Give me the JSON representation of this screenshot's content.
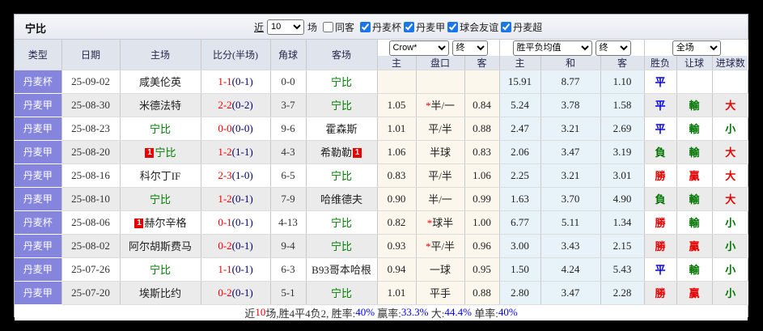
{
  "colors": {
    "red": "#e60000",
    "green": "#007500",
    "blue": "#0000ee",
    "black": "#333333",
    "league_cell": "#8585de",
    "crow_col_bg": "#fcf7ed",
    "avg_col_bg": "#e7f3f8"
  },
  "topbar": {
    "team": "宁比",
    "recent_label": "近",
    "recent_value": "10",
    "matches_label": "场",
    "same_away_label": "同客",
    "same_away_checked": false,
    "leagues": [
      {
        "label": "丹麦杯",
        "checked": true
      },
      {
        "label": "丹麦甲",
        "checked": true
      },
      {
        "label": "球会友谊",
        "checked": true
      },
      {
        "label": "丹麦超",
        "checked": true
      }
    ]
  },
  "selects": {
    "bookmaker": "Crow*",
    "bookmaker_state": "终",
    "avg": "胜平负均值",
    "avg_state": "终",
    "scope": "全场"
  },
  "table": {
    "headers": {
      "type": "类型",
      "date": "日期",
      "home": "主场",
      "score": "比分(半场)",
      "corner": "角球",
      "away": "客场",
      "odds_home": "主",
      "odds_handicap": "盘口",
      "odds_away": "客",
      "avg_home": "主",
      "avg_draw": "和",
      "avg_away": "客",
      "result": "胜负",
      "handicap_result": "让球",
      "goals": "进球数"
    },
    "rows": [
      {
        "league": "丹麦杯",
        "date": "25-09-02",
        "home": {
          "name": "咸美伦英",
          "self": false,
          "badge": null,
          "badge_pos": null
        },
        "score": {
          "ft": "1-1",
          "ht": "(0-1)"
        },
        "corner": "0-0",
        "away": {
          "name": "宁比",
          "self": true,
          "badge": null,
          "badge_pos": null
        },
        "odds": {
          "home": "",
          "handicap": "",
          "star": false,
          "away": ""
        },
        "avg": {
          "home": "15.91",
          "draw": "8.77",
          "away": "1.10"
        },
        "result": {
          "text": "平",
          "color": "blue"
        },
        "handicap_result": {
          "text": "",
          "color": ""
        },
        "goals": {
          "text": "",
          "color": ""
        }
      },
      {
        "league": "丹麦甲",
        "date": "25-08-30",
        "home": {
          "name": "米德法特",
          "self": false,
          "badge": null,
          "badge_pos": null
        },
        "score": {
          "ft": "2-2",
          "ht": "(0-2)"
        },
        "corner": "3-7",
        "away": {
          "name": "宁比",
          "self": true,
          "badge": null,
          "badge_pos": null
        },
        "odds": {
          "home": "1.05",
          "handicap": "半/一",
          "star": true,
          "away": "0.84"
        },
        "avg": {
          "home": "5.24",
          "draw": "3.78",
          "away": "1.58"
        },
        "result": {
          "text": "平",
          "color": "blue"
        },
        "handicap_result": {
          "text": "輸",
          "color": "green"
        },
        "goals": {
          "text": "大",
          "color": "red"
        }
      },
      {
        "league": "丹麦甲",
        "date": "25-08-23",
        "home": {
          "name": "宁比",
          "self": true,
          "badge": null,
          "badge_pos": null
        },
        "score": {
          "ft": "0-0",
          "ht": "(0-0)"
        },
        "corner": "9-6",
        "away": {
          "name": "霍森斯",
          "self": false,
          "badge": null,
          "badge_pos": null
        },
        "odds": {
          "home": "1.01",
          "handicap": "平/半",
          "star": false,
          "away": "0.88"
        },
        "avg": {
          "home": "2.47",
          "draw": "3.21",
          "away": "2.69"
        },
        "result": {
          "text": "平",
          "color": "blue"
        },
        "handicap_result": {
          "text": "輸",
          "color": "green"
        },
        "goals": {
          "text": "小",
          "color": "green"
        }
      },
      {
        "league": "丹麦甲",
        "date": "25-08-20",
        "home": {
          "name": "宁比",
          "self": true,
          "badge": "1",
          "badge_pos": "before"
        },
        "score": {
          "ft": "1-2",
          "ht": "(1-1)"
        },
        "corner": "4-3",
        "away": {
          "name": "希勒勒",
          "self": false,
          "badge": "1",
          "badge_pos": "after"
        },
        "odds": {
          "home": "1.06",
          "handicap": "半球",
          "star": false,
          "away": "0.83"
        },
        "avg": {
          "home": "2.06",
          "draw": "3.47",
          "away": "3.19"
        },
        "result": {
          "text": "負",
          "color": "green"
        },
        "handicap_result": {
          "text": "輸",
          "color": "green"
        },
        "goals": {
          "text": "大",
          "color": "red"
        }
      },
      {
        "league": "丹麦甲",
        "date": "25-08-16",
        "home": {
          "name": "科尔丁IF",
          "self": false,
          "badge": null,
          "badge_pos": null
        },
        "score": {
          "ft": "2-3",
          "ht": "(1-0)"
        },
        "corner": "6-5",
        "away": {
          "name": "宁比",
          "self": true,
          "badge": null,
          "badge_pos": null
        },
        "odds": {
          "home": "0.83",
          "handicap": "平/半",
          "star": false,
          "away": "1.06"
        },
        "avg": {
          "home": "2.25",
          "draw": "3.21",
          "away": "3.01"
        },
        "result": {
          "text": "勝",
          "color": "red"
        },
        "handicap_result": {
          "text": "贏",
          "color": "red"
        },
        "goals": {
          "text": "大",
          "color": "red"
        }
      },
      {
        "league": "丹麦甲",
        "date": "25-08-10",
        "home": {
          "name": "宁比",
          "self": true,
          "badge": null,
          "badge_pos": null
        },
        "score": {
          "ft": "1-2",
          "ht": "(0-1)"
        },
        "corner": "7-9",
        "away": {
          "name": "哈维德夫",
          "self": false,
          "badge": null,
          "badge_pos": null
        },
        "odds": {
          "home": "0.90",
          "handicap": "半/一",
          "star": false,
          "away": "0.99"
        },
        "avg": {
          "home": "1.63",
          "draw": "3.70",
          "away": "4.90"
        },
        "result": {
          "text": "負",
          "color": "green"
        },
        "handicap_result": {
          "text": "輸",
          "color": "green"
        },
        "goals": {
          "text": "大",
          "color": "red"
        }
      },
      {
        "league": "丹麦杯",
        "date": "25-08-06",
        "home": {
          "name": "赫尔辛格",
          "self": false,
          "badge": "1",
          "badge_pos": "before"
        },
        "score": {
          "ft": "0-1",
          "ht": "(0-1)"
        },
        "corner": "4-13",
        "away": {
          "name": "宁比",
          "self": true,
          "badge": null,
          "badge_pos": null
        },
        "odds": {
          "home": "0.82",
          "handicap": "球半",
          "star": true,
          "away": "1.00"
        },
        "avg": {
          "home": "6.77",
          "draw": "5.11",
          "away": "1.34"
        },
        "result": {
          "text": "勝",
          "color": "red"
        },
        "handicap_result": {
          "text": "輸",
          "color": "green"
        },
        "goals": {
          "text": "小",
          "color": "green"
        }
      },
      {
        "league": "丹麦甲",
        "date": "25-08-02",
        "home": {
          "name": "阿尔胡斯费马",
          "self": false,
          "badge": null,
          "badge_pos": null
        },
        "score": {
          "ft": "0-2",
          "ht": "(0-1)"
        },
        "corner": "9-4",
        "away": {
          "name": "宁比",
          "self": true,
          "badge": null,
          "badge_pos": null
        },
        "odds": {
          "home": "0.93",
          "handicap": "平/半",
          "star": true,
          "away": "0.96"
        },
        "avg": {
          "home": "3.00",
          "draw": "3.43",
          "away": "2.15"
        },
        "result": {
          "text": "勝",
          "color": "red"
        },
        "handicap_result": {
          "text": "贏",
          "color": "red"
        },
        "goals": {
          "text": "小",
          "color": "green"
        }
      },
      {
        "league": "丹麦甲",
        "date": "25-07-26",
        "home": {
          "name": "宁比",
          "self": true,
          "badge": null,
          "badge_pos": null
        },
        "score": {
          "ft": "1-1",
          "ht": "(0-1)"
        },
        "corner": "6-3",
        "away": {
          "name": "B93哥本哈根",
          "self": false,
          "badge": null,
          "badge_pos": null
        },
        "odds": {
          "home": "0.94",
          "handicap": "一球",
          "star": false,
          "away": "0.95"
        },
        "avg": {
          "home": "1.50",
          "draw": "4.24",
          "away": "5.43"
        },
        "result": {
          "text": "平",
          "color": "blue"
        },
        "handicap_result": {
          "text": "輸",
          "color": "green"
        },
        "goals": {
          "text": "小",
          "color": "green"
        }
      },
      {
        "league": "丹麦甲",
        "date": "25-07-20",
        "home": {
          "name": "埃斯比约",
          "self": false,
          "badge": null,
          "badge_pos": null
        },
        "score": {
          "ft": "0-2",
          "ht": "(0-1)"
        },
        "corner": "5-1",
        "away": {
          "name": "宁比",
          "self": true,
          "badge": null,
          "badge_pos": null
        },
        "odds": {
          "home": "1.01",
          "handicap": "平手",
          "star": false,
          "away": "0.88"
        },
        "avg": {
          "home": "2.80",
          "draw": "3.47",
          "away": "2.28"
        },
        "result": {
          "text": "勝",
          "color": "red"
        },
        "handicap_result": {
          "text": "贏",
          "color": "red"
        },
        "goals": {
          "text": "小",
          "color": "green"
        }
      }
    ]
  },
  "footer": {
    "segments": [
      {
        "text": "近",
        "color": "black"
      },
      {
        "text": "10",
        "color": "red"
      },
      {
        "text": "场,胜4平4负2, 胜率:",
        "color": "black"
      },
      {
        "text": "40%",
        "color": "blue"
      },
      {
        "text": " 赢率:",
        "color": "black"
      },
      {
        "text": "33.3%",
        "color": "blue"
      },
      {
        "text": " 大:",
        "color": "black"
      },
      {
        "text": "44.4%",
        "color": "blue"
      },
      {
        "text": " 单率:",
        "color": "black"
      },
      {
        "text": "40%",
        "color": "blue"
      }
    ]
  }
}
